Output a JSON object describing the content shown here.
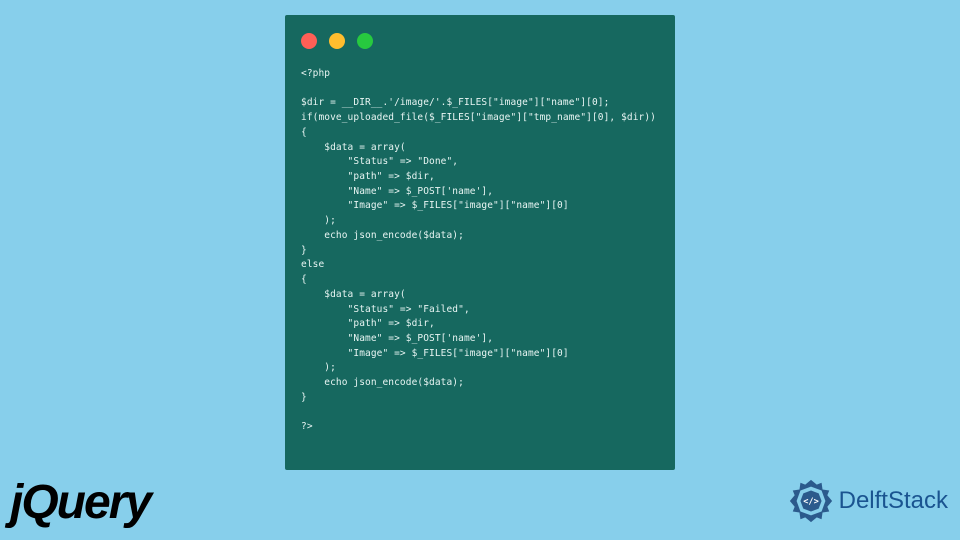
{
  "code": {
    "line1": "<?php",
    "line2": "",
    "line3": "$dir = __DIR__.'/image/'.$_FILES[\"image\"][\"name\"][0];",
    "line4": "if(move_uploaded_file($_FILES[\"image\"][\"tmp_name\"][0], $dir))",
    "line5": "{",
    "line6": "    $data = array(",
    "line7": "        \"Status\" => \"Done\",",
    "line8": "        \"path\" => $dir,",
    "line9": "        \"Name\" => $_POST['name'],",
    "line10": "        \"Image\" => $_FILES[\"image\"][\"name\"][0]",
    "line11": "    );",
    "line12": "    echo json_encode($data);",
    "line13": "}",
    "line14": "else",
    "line15": "{",
    "line16": "    $data = array(",
    "line17": "        \"Status\" => \"Failed\",",
    "line18": "        \"path\" => $dir,",
    "line19": "        \"Name\" => $_POST['name'],",
    "line20": "        \"Image\" => $_FILES[\"image\"][\"name\"][0]",
    "line21": "    );",
    "line22": "    echo json_encode($data);",
    "line23": "}",
    "line24": "",
    "line25": "?>"
  },
  "logos": {
    "jquery": "jQuery",
    "delftstack": "DelftStack"
  }
}
